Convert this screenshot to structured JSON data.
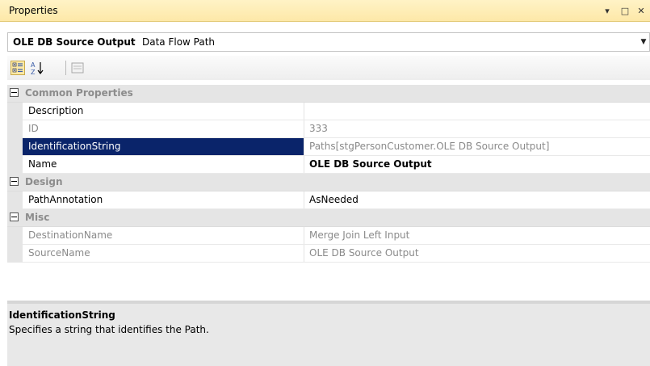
{
  "window": {
    "title": "Properties",
    "controls": {
      "dropdown": "▾",
      "maximize": "□",
      "close": "✕"
    }
  },
  "selector": {
    "object_name": "OLE DB Source Output",
    "object_type": "Data Flow Path",
    "arrow": "▼"
  },
  "toolbar": {
    "icons": [
      "categorized-icon",
      "alphabetical-icon",
      "property-pages-icon"
    ]
  },
  "grid": {
    "categories": [
      {
        "label": "Common Properties",
        "properties": [
          {
            "name": "Description",
            "value": ""
          },
          {
            "name": "ID",
            "value": "333"
          },
          {
            "name": "IdentificationString",
            "value": "Paths[stgPersonCustomer.OLE DB Source Output]"
          },
          {
            "name": "Name",
            "value": "OLE DB Source Output"
          }
        ]
      },
      {
        "label": "Design",
        "properties": [
          {
            "name": "PathAnnotation",
            "value": "AsNeeded"
          }
        ]
      },
      {
        "label": "Misc",
        "properties": [
          {
            "name": "DestinationName",
            "value": "Merge Join Left Input"
          },
          {
            "name": "SourceName",
            "value": "OLE DB Source Output"
          }
        ]
      }
    ]
  },
  "description": {
    "title": "IdentificationString",
    "text": "Specifies a string that identifies the Path."
  },
  "colors": {
    "titlebar": "#fde8a8",
    "selection": "#0a246a",
    "category_bg": "#e5e5e5",
    "readonly_text": "#8a8a8a"
  }
}
